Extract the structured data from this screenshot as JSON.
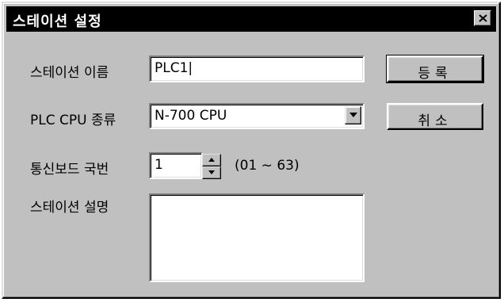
{
  "window": {
    "title": "스테이션 설정",
    "close_icon": "close-icon"
  },
  "form": {
    "station_name_label": "스테이션 이름",
    "station_name_value": "PLC1|",
    "cpu_type_label": "PLC CPU 종류",
    "cpu_type_value": "N-700 CPU",
    "board_no_label": "통신보드 국번",
    "board_no_value": "1",
    "board_no_range": "(01 ~ 63)",
    "description_label": "스테이션 설명",
    "description_value": ""
  },
  "buttons": {
    "register": "등록",
    "cancel": "취소"
  },
  "colors": {
    "dialog_bg": "#c0c0c0",
    "titlebar_bg": "#000000",
    "title_text": "#ffffff",
    "field_bg": "#ffffff"
  }
}
